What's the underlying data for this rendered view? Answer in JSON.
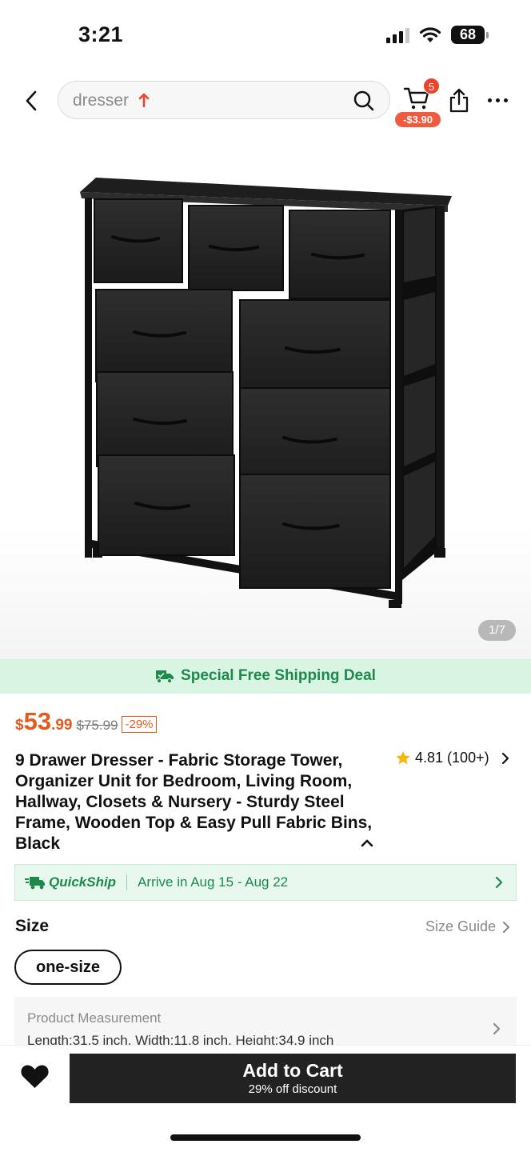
{
  "status_bar": {
    "time": "3:21",
    "battery": "68"
  },
  "header": {
    "search_text": "dresser",
    "cart_badge": "5",
    "cart_discount": "-$3.90"
  },
  "gallery": {
    "counter": "1/7"
  },
  "shipping_banner": {
    "text": "Special Free Shipping Deal"
  },
  "price": {
    "currency": "$",
    "integer": "53",
    "decimal": ".99",
    "original": "$75.99",
    "discount": "-29%"
  },
  "product": {
    "title": "9 Drawer Dresser - Fabric Storage Tower, Organizer Unit for Bedroom, Living Room, Hallway, Closets & Nursery - Sturdy Steel Frame, Wooden Top & Easy Pull Fabric Bins, Black",
    "rating": "4.81",
    "review_count": "(100+)"
  },
  "quickship": {
    "brand": "QuickShip",
    "arrival": "Arrive in Aug 15 - Aug 22"
  },
  "size": {
    "label": "Size",
    "guide": "Size Guide",
    "selected": "one-size"
  },
  "measurement": {
    "title": "Product Measurement",
    "value": "Length:31.5 inch, Width:11.8 inch, Height:34.9 inch"
  },
  "bottom_bar": {
    "add_to_cart": "Add to Cart",
    "discount_note": "29% off discount"
  },
  "colors": {
    "price": "#e35a1f",
    "green": "#1d8a4b",
    "banner_bg": "#d9f4e3",
    "cart_button": "#222222"
  },
  "icons": [
    "back-icon",
    "search-icon",
    "cart-icon",
    "share-icon",
    "more-icon",
    "truck-icon",
    "star-icon",
    "heart-icon"
  ]
}
